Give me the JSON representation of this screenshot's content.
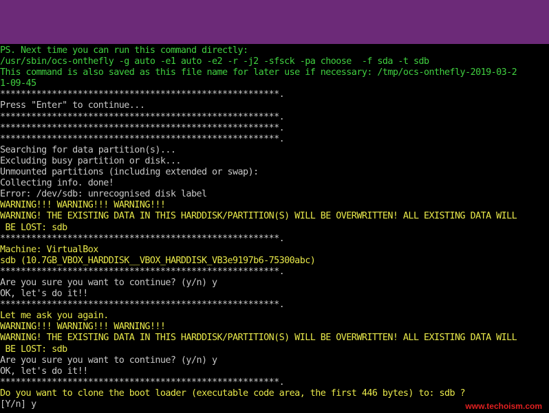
{
  "terminal": {
    "lines": [
      {
        "text": "PS. Next time you can run this command directly:",
        "color": "green"
      },
      {
        "text": "/usr/sbin/ocs-onthefly -g auto -e1 auto -e2 -r -j2 -sfsck -pa choose  -f sda -t sdb",
        "color": "green"
      },
      {
        "text": "This command is also saved as this file name for later use if necessary: /tmp/ocs-onthefly-2019-03-2",
        "color": "green"
      },
      {
        "text": "1-09-45",
        "color": "green"
      },
      {
        "text": "******************************************************.",
        "color": "white"
      },
      {
        "text": "Press \"Enter\" to continue...",
        "color": "white"
      },
      {
        "text": "******************************************************.",
        "color": "white"
      },
      {
        "text": "******************************************************.",
        "color": "white"
      },
      {
        "text": "******************************************************.",
        "color": "white"
      },
      {
        "text": "Searching for data partition(s)...",
        "color": "white"
      },
      {
        "text": "Excluding busy partition or disk...",
        "color": "white"
      },
      {
        "text": "Unmounted partitions (including extended or swap):",
        "color": "white"
      },
      {
        "text": "Collecting info. done!",
        "color": "white"
      },
      {
        "text": "Error: /dev/sdb: unrecognised disk label",
        "color": "white"
      },
      {
        "text": "WARNING!!! WARNING!!! WARNING!!!",
        "color": "yellow"
      },
      {
        "text": "WARNING! THE EXISTING DATA IN THIS HARDDISK/PARTITION(S) WILL BE OVERWRITTEN! ALL EXISTING DATA WILL",
        "color": "yellow"
      },
      {
        "text": " BE LOST: sdb",
        "color": "yellow"
      },
      {
        "text": "******************************************************.",
        "color": "white"
      },
      {
        "text": "Machine: VirtualBox",
        "color": "yellow"
      },
      {
        "text": "sdb (10.7GB_VBOX_HARDDISK__VBOX_HARDDISK_VB3e9197b6-75300abc)",
        "color": "yellow"
      },
      {
        "text": "******************************************************.",
        "color": "white"
      },
      {
        "text": "Are you sure you want to continue? (y/n) y",
        "color": "white"
      },
      {
        "text": "OK, let's do it!!",
        "color": "white"
      },
      {
        "text": "******************************************************.",
        "color": "white"
      },
      {
        "text": "Let me ask you again.",
        "color": "yellow"
      },
      {
        "text": "WARNING!!! WARNING!!! WARNING!!!",
        "color": "yellow"
      },
      {
        "text": "WARNING! THE EXISTING DATA IN THIS HARDDISK/PARTITION(S) WILL BE OVERWRITTEN! ALL EXISTING DATA WILL",
        "color": "yellow"
      },
      {
        "text": " BE LOST: sdb",
        "color": "yellow"
      },
      {
        "text": "Are you sure you want to continue? (y/n) y",
        "color": "white"
      },
      {
        "text": "OK, let's do it!!",
        "color": "white"
      },
      {
        "text": "******************************************************.",
        "color": "white"
      },
      {
        "text": "Do you want to clone the boot loader (executable code area, the first 446 bytes) to: sdb ?",
        "color": "yellow"
      },
      {
        "text": "[Y/n] y",
        "color": "white"
      }
    ]
  },
  "watermark": "www.techoism.com",
  "colors": {
    "titlebar": "#6c2a78",
    "background": "#000000",
    "white": "#c8c8c8",
    "green": "#40d040",
    "yellow": "#e8e84a",
    "watermark": "#e02020"
  }
}
